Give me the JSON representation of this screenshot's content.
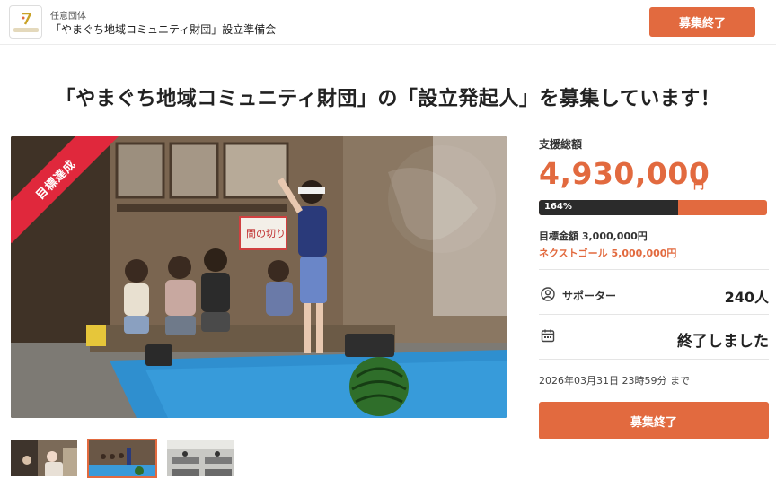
{
  "header": {
    "org_type": "任意団体",
    "org_name": "「やまぐち地域コミュニティ財団」設立準備会",
    "button_label": "募集終了"
  },
  "page_title": "「やまぐち地域コミュニティ財団」の「設立発起人」を募集しています！",
  "main_image": {
    "ribbon_label": "目標達成",
    "sign_text": "間の切り"
  },
  "thumbnails": [
    {
      "name": "thumb-1",
      "active": false
    },
    {
      "name": "thumb-2",
      "active": true
    },
    {
      "name": "thumb-3",
      "active": false
    }
  ],
  "sidebar": {
    "total_label": "支援総額",
    "total_amount": "4,930,000",
    "yen": "円",
    "progress_percent": 164,
    "progress_label": "164%",
    "goal_text": "目標金額 3,000,000円",
    "next_goal_text": "ネクストゴール 5,000,000円",
    "supporters_label": "サポーター",
    "supporters_count": "240人",
    "status_text": "終了しました",
    "deadline_text": "2026年03月31日 23時59分 まで",
    "button_label": "募集終了"
  },
  "colors": {
    "accent": "#e26a3f",
    "ribbon": "#e0283c",
    "progress_dark": "#2b2b2b"
  },
  "icons": [
    "person-circle-icon",
    "calendar-icon",
    "logo-icon"
  ]
}
